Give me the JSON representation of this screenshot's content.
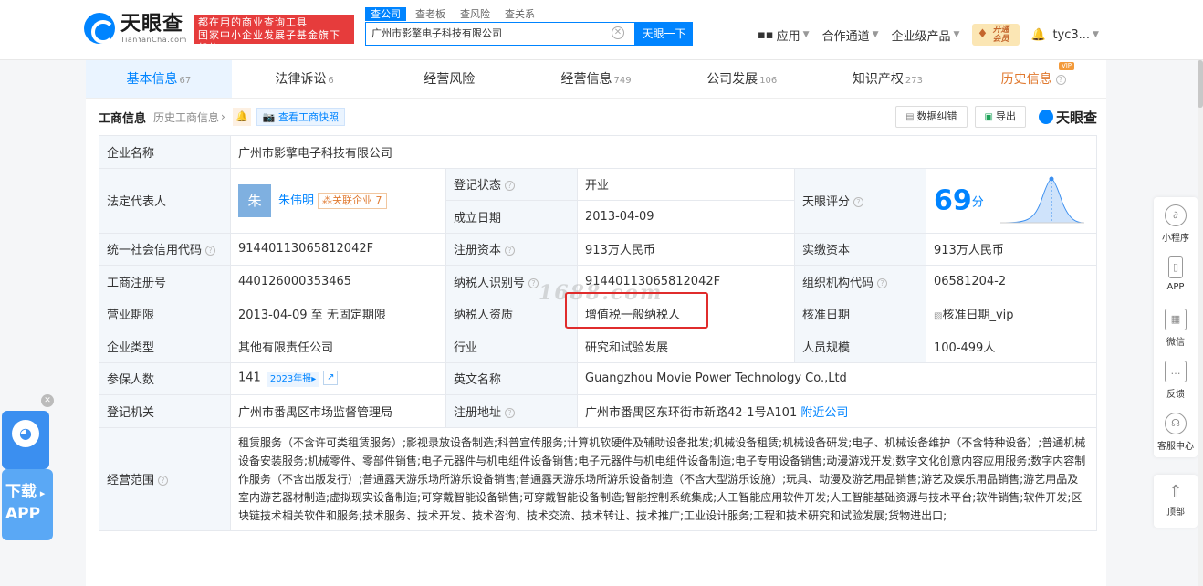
{
  "header": {
    "logo_cn": "天眼查",
    "logo_en": "TianYanCha.com",
    "slogan_line1": "都在用的商业查询工具",
    "slogan_line2": "国家中小企业发展子基金旗下机构",
    "search_tabs": [
      "查公司",
      "查老板",
      "查风险",
      "查关系"
    ],
    "search_value": "广州市影擎电子科技有限公司",
    "search_button": "天眼一下",
    "nav": [
      "应用",
      "合作通道",
      "企业级产品"
    ],
    "vip_label_1": "开通",
    "vip_label_2": "会员",
    "user": "tyc3..."
  },
  "tabs": [
    {
      "label": "基本信息",
      "count": "67"
    },
    {
      "label": "法律诉讼",
      "count": "6"
    },
    {
      "label": "经营风险",
      "count": ""
    },
    {
      "label": "经营信息",
      "count": "749"
    },
    {
      "label": "公司发展",
      "count": "106"
    },
    {
      "label": "知识产权",
      "count": "273"
    },
    {
      "label": "历史信息",
      "count": "",
      "badge": "VIP"
    }
  ],
  "section": {
    "title": "工商信息",
    "history": "历史工商信息",
    "snapshot": "查看工商快照",
    "correct": "数据纠错",
    "export": "导出",
    "brand": "天眼查"
  },
  "info": {
    "company_name_label": "企业名称",
    "company_name": "广州市影擎电子科技有限公司",
    "legal_rep_label": "法定代表人",
    "legal_rep_avatar": "朱",
    "legal_rep_name": "朱伟明",
    "related_label": "关联企业",
    "related_count": "7",
    "reg_status_label": "登记状态",
    "reg_status": "开业",
    "est_date_label": "成立日期",
    "est_date": "2013-04-09",
    "score_label": "天眼评分",
    "score": "69",
    "score_unit": "分",
    "credit_code_label": "统一社会信用代码",
    "credit_code": "91440113065812042F",
    "reg_capital_label": "注册资本",
    "reg_capital": "913万人民币",
    "paid_capital_label": "实缴资本",
    "paid_capital": "913万人民币",
    "reg_no_label": "工商注册号",
    "reg_no": "440126000353465",
    "taxpayer_id_label": "纳税人识别号",
    "taxpayer_id": "91440113065812042F",
    "org_code_label": "组织机构代码",
    "org_code": "06581204-2",
    "term_label": "营业期限",
    "term": "2013-04-09 至 无固定期限",
    "taxpayer_qual_label": "纳税人资质",
    "taxpayer_qual": "增值税一般纳税人",
    "approve_date_label": "核准日期",
    "approve_date": "核准日期_vip",
    "type_label": "企业类型",
    "type": "其他有限责任公司",
    "industry_label": "行业",
    "industry": "研究和试验发展",
    "staff_label": "人员规模",
    "staff": "100-499人",
    "insured_label": "参保人数",
    "insured": "141",
    "insured_year": "2023年报",
    "en_name_label": "英文名称",
    "en_name": "Guangzhou Movie Power Technology Co.,Ltd",
    "authority_label": "登记机关",
    "authority": "广州市番禺区市场监督管理局",
    "address_label": "注册地址",
    "address": "广州市番禺区东环街市新路42-1号A101",
    "nearby": "附近公司",
    "scope_label": "经营范围",
    "scope": "租赁服务（不含许可类租赁服务）;影视录放设备制造;科普宣传服务;计算机软硬件及辅助设备批发;机械设备租赁;机械设备研发;电子、机械设备维护（不含特种设备）;普通机械设备安装服务;机械零件、零部件销售;电子元器件与机电组件设备销售;电子元器件与机电组件设备制造;电子专用设备销售;动漫游戏开发;数字文化创意内容应用服务;数字内容制作服务（不含出版发行）;普通露天游乐场所游乐设备销售;普通露天游乐场所游乐设备制造（不含大型游乐设施）;玩具、动漫及游艺用品销售;游艺及娱乐用品销售;游艺用品及室内游艺器材制造;虚拟现实设备制造;可穿戴智能设备销售;可穿戴智能设备制造;智能控制系统集成;人工智能应用软件开发;人工智能基础资源与技术平台;软件销售;软件开发;区块链技术相关软件和服务;技术服务、技术开发、技术咨询、技术交流、技术转让、技术推广;工业设计服务;工程和技术研究和试验发展;货物进出口;"
  },
  "watermark": "1688.com",
  "right_sidebar": [
    "小程序",
    "APP",
    "微信",
    "反馈",
    "客服中心",
    "顶部"
  ],
  "download": {
    "line1": "下载",
    "line2": "APP"
  }
}
